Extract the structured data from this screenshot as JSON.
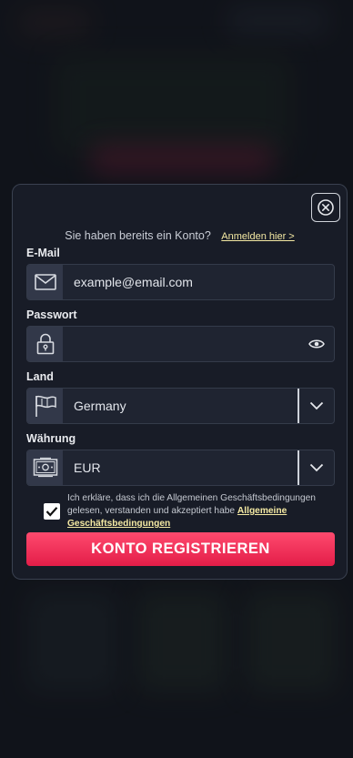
{
  "login_prompt": {
    "text": "Sie haben bereits ein Konto?",
    "link": "Anmelden hier >"
  },
  "email": {
    "label": "E-Mail",
    "placeholder": "example@email.com",
    "icon": "envelope-icon"
  },
  "password": {
    "label": "Passwort",
    "value": "",
    "icon": "lock-icon",
    "toggle_icon": "eye-icon"
  },
  "country": {
    "label": "Land",
    "selected": "Germany",
    "icon": "flag-icon"
  },
  "currency": {
    "label": "Währung",
    "selected": "EUR",
    "icon": "banknote-icon"
  },
  "terms": {
    "checked": true,
    "text": "Ich erkläre, dass ich die Allgemeinen Geschäftsbedingungen gelesen, verstanden und akzeptiert habe",
    "link": "Allgemeine Geschäftsbedingungen"
  },
  "submit_label": "KONTO REGISTRIEREN",
  "colors": {
    "accent": "#e9234c",
    "link": "#f4e9a3",
    "panel": "#181c27"
  }
}
